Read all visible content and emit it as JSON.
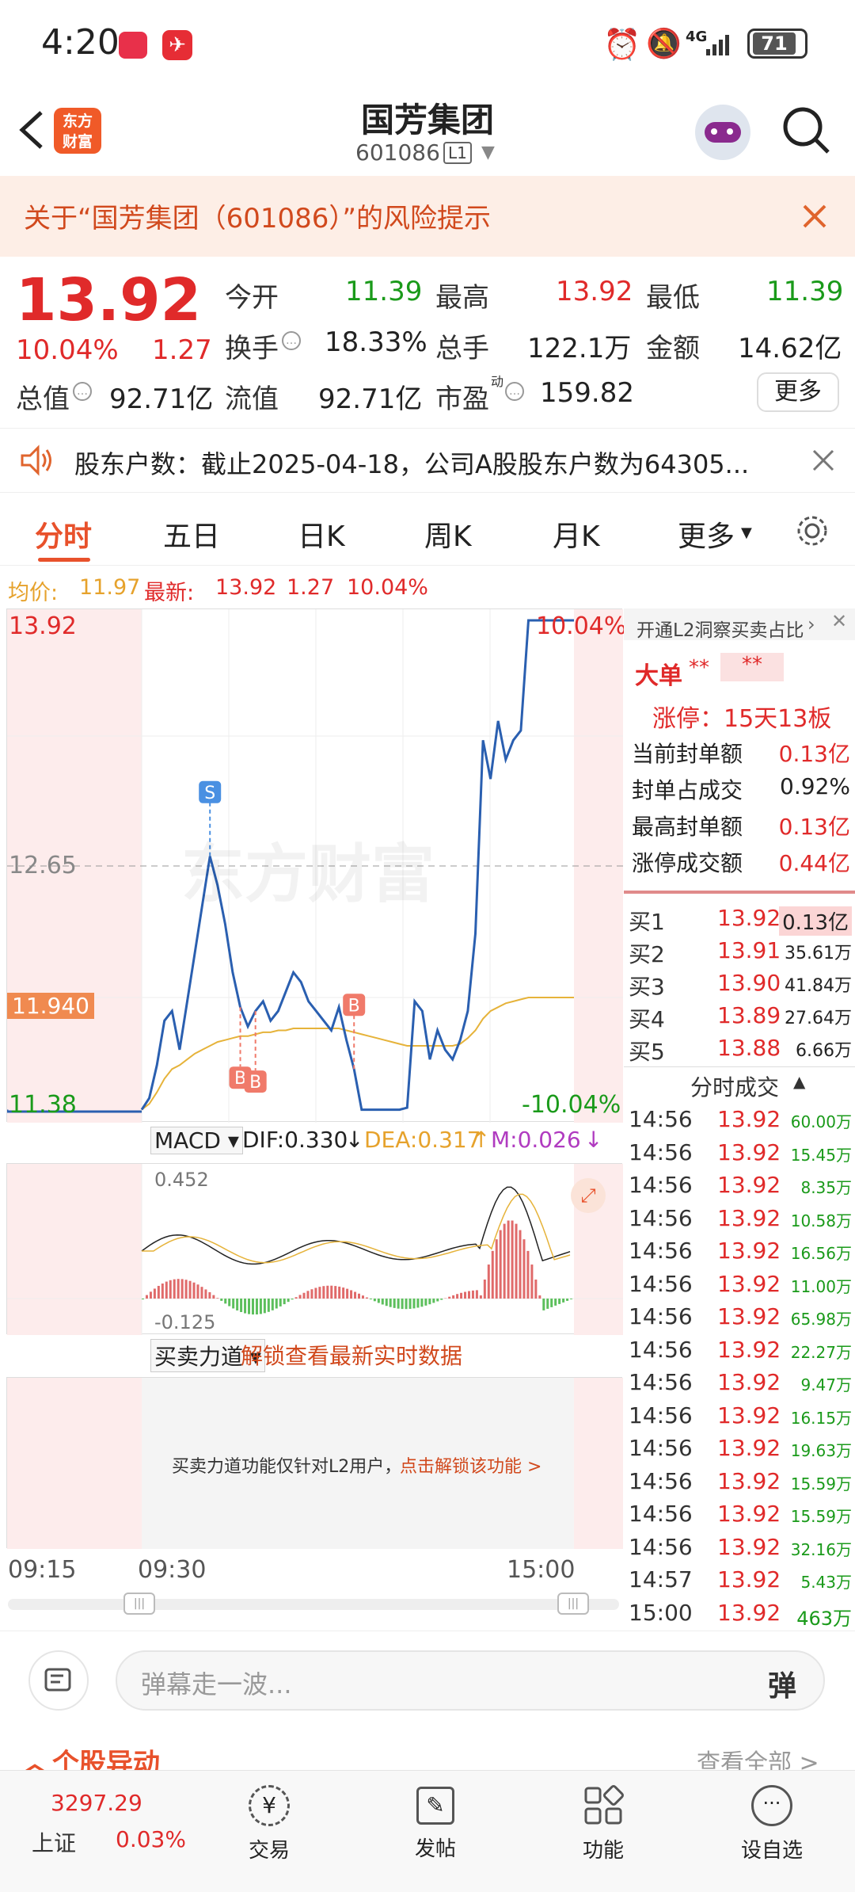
{
  "status_bar": {
    "time": "4:20",
    "battery": "71",
    "network": "4G"
  },
  "header": {
    "title": "国芳集团",
    "code": "601086",
    "level_badge": "L1",
    "logo_text_1": "东方",
    "logo_text_2": "财富"
  },
  "risk_banner": {
    "text": "关于“国芳集团（601086）”的风险提示"
  },
  "quote": {
    "price": "13.92",
    "change_pct": "10.04%",
    "change": "1.27",
    "open_label": "今开",
    "open": "11.39",
    "high_label": "最高",
    "high": "13.92",
    "low_label": "最低",
    "low": "11.39",
    "turnover_label": "换手",
    "turnover": "18.33%",
    "volume_label": "总手",
    "volume": "122.1万",
    "amount_label": "金额",
    "amount": "14.62亿",
    "mktcap_label": "总值",
    "mktcap": "92.71亿",
    "float_label": "流值",
    "float": "92.71亿",
    "pe_label": "市盈",
    "pe_sup": "动",
    "pe": "159.82",
    "more_button": "更多"
  },
  "notice": {
    "text": "股东户数：截止2025-04-18，公司A股股东户数为64305..."
  },
  "chart_tabs": {
    "items": [
      "分时",
      "五日",
      "日K",
      "周K",
      "月K",
      "更多"
    ],
    "active": "分时"
  },
  "avg_line": {
    "avg_label": "均价:",
    "avg": "11.97",
    "latest_label": "最新:",
    "latest": "13.92",
    "chg": "1.27",
    "pct": "10.04%"
  },
  "chart_data": {
    "type": "line",
    "price_axis": {
      "top": "13.92",
      "mid": "12.65",
      "bottom": "11.38",
      "top_pct": "10.04%",
      "bottom_pct": "-10.04%",
      "cursor": "11.940"
    },
    "time_axis": [
      "09:15",
      "09:30",
      "15:00"
    ],
    "ylim": [
      11.38,
      13.92
    ],
    "price": [
      11.39,
      11.45,
      11.62,
      11.85,
      11.9,
      11.7,
      11.95,
      12.2,
      12.45,
      12.7,
      12.55,
      12.35,
      12.1,
      11.92,
      11.82,
      11.9,
      11.95,
      11.85,
      11.9,
      12.0,
      12.1,
      12.05,
      11.95,
      11.9,
      11.85,
      11.8,
      11.92,
      11.75,
      11.6,
      11.39,
      11.39,
      11.39,
      11.39,
      11.39,
      11.39,
      11.4,
      11.95,
      11.9,
      11.65,
      11.8,
      11.7,
      11.65,
      11.75,
      11.9,
      12.3,
      13.3,
      13.1,
      13.4,
      13.2,
      13.3,
      13.35,
      13.92,
      13.92,
      13.92,
      13.92,
      13.92,
      13.92,
      13.92
    ],
    "avg": [
      11.39,
      11.42,
      11.48,
      11.55,
      11.6,
      11.62,
      11.65,
      11.68,
      11.7,
      11.72,
      11.74,
      11.75,
      11.76,
      11.77,
      11.77,
      11.78,
      11.79,
      11.79,
      11.8,
      11.8,
      11.81,
      11.81,
      11.81,
      11.81,
      11.81,
      11.81,
      11.81,
      11.8,
      11.79,
      11.78,
      11.77,
      11.76,
      11.75,
      11.74,
      11.73,
      11.72,
      11.72,
      11.72,
      11.72,
      11.72,
      11.72,
      11.72,
      11.73,
      11.76,
      11.8,
      11.86,
      11.9,
      11.92,
      11.94,
      11.95,
      11.96,
      11.97,
      11.97,
      11.97,
      11.97,
      11.97,
      11.97,
      11.97
    ],
    "markers": [
      {
        "label": "S"
      },
      {
        "label": "B"
      },
      {
        "label": "B"
      },
      {
        "label": "B"
      }
    ],
    "watermark": "东方财富"
  },
  "macd": {
    "selector": "MACD",
    "dif": "DIF:0.330",
    "dea": "DEA:0.317",
    "m": "M:0.026",
    "top": "0.452",
    "bottom": "-0.125"
  },
  "force": {
    "selector": "买卖力道",
    "unlock": "解锁查看最新实时数据",
    "desc": "买卖力道功能仅针对L2用户，",
    "link": "点击解锁该功能 >"
  },
  "l2_panel": {
    "header": "开通L2洞察买卖占比",
    "big_order_label": "大单",
    "stars": "**",
    "limit_up": "涨停：15天13板",
    "rows": [
      {
        "label": "当前封单额",
        "value": "0.13亿"
      },
      {
        "label": "封单占成交",
        "value": "0.92%"
      },
      {
        "label": "最高封单额",
        "value": "0.13亿"
      },
      {
        "label": "涨停成交额",
        "value": "0.44亿"
      }
    ],
    "bids": [
      {
        "label": "买1",
        "price": "13.92",
        "vol": "0.13亿"
      },
      {
        "label": "买2",
        "price": "13.91",
        "vol": "35.61万"
      },
      {
        "label": "买3",
        "price": "13.90",
        "vol": "41.84万"
      },
      {
        "label": "买4",
        "price": "13.89",
        "vol": "27.64万"
      },
      {
        "label": "买5",
        "price": "13.88",
        "vol": "6.66万"
      }
    ],
    "ticks_title": "分时成交",
    "ticks": [
      {
        "t": "14:56",
        "p": "13.92",
        "v": "60.00万"
      },
      {
        "t": "14:56",
        "p": "13.92",
        "v": "15.45万"
      },
      {
        "t": "14:56",
        "p": "13.92",
        "v": "8.35万"
      },
      {
        "t": "14:56",
        "p": "13.92",
        "v": "10.58万"
      },
      {
        "t": "14:56",
        "p": "13.92",
        "v": "16.56万"
      },
      {
        "t": "14:56",
        "p": "13.92",
        "v": "11.00万"
      },
      {
        "t": "14:56",
        "p": "13.92",
        "v": "65.98万"
      },
      {
        "t": "14:56",
        "p": "13.92",
        "v": "22.27万"
      },
      {
        "t": "14:56",
        "p": "13.92",
        "v": "9.47万"
      },
      {
        "t": "14:56",
        "p": "13.92",
        "v": "16.15万"
      },
      {
        "t": "14:56",
        "p": "13.92",
        "v": "19.63万"
      },
      {
        "t": "14:56",
        "p": "13.92",
        "v": "15.59万"
      },
      {
        "t": "14:56",
        "p": "13.92",
        "v": "15.59万"
      },
      {
        "t": "14:56",
        "p": "13.92",
        "v": "32.16万"
      },
      {
        "t": "14:57",
        "p": "13.92",
        "v": "5.43万"
      },
      {
        "t": "15:00",
        "p": "13.92",
        "v": "463万"
      }
    ]
  },
  "comment": {
    "placeholder": "弹幕走一波...",
    "send": "弹"
  },
  "section": {
    "title": "个股异动",
    "more": "查看全部 >"
  },
  "bottom_nav": {
    "index_value": "3297.29",
    "index_name": "上证",
    "index_pct": "0.03%",
    "items": [
      "交易",
      "发帖",
      "功能",
      "设自选"
    ]
  },
  "colors": {
    "up": "#e02a2a",
    "down": "#1a9a1a",
    "accent": "#e8512b",
    "price_line": "#2a5fb0",
    "avg_line": "#e6b33a"
  }
}
